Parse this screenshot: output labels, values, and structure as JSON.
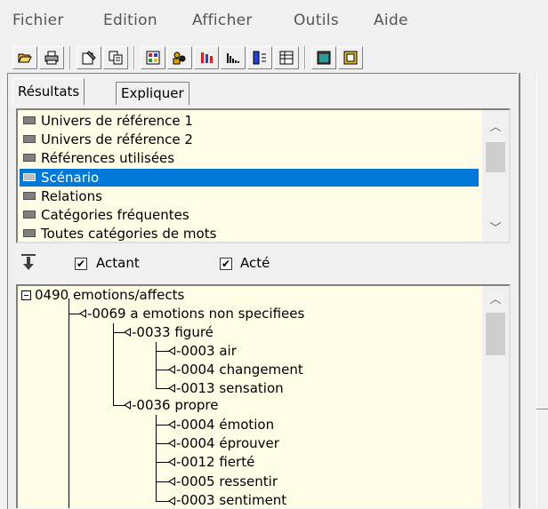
{
  "menu": [
    "Fichier",
    "Edition",
    "Afficher",
    "Outils",
    "Aide"
  ],
  "toolbar": {
    "buttons": [
      "open-folder-icon",
      "print-icon",
      "properties-icon",
      "copy-icon",
      "grid-icon",
      "people-icon",
      "bars-icon",
      "histogram-icon",
      "split-icon",
      "table-icon",
      "window-icon",
      "export-icon"
    ]
  },
  "tabs": {
    "results": "Résultats",
    "explain": "Expliquer"
  },
  "list": {
    "items": [
      "Univers de référence 1",
      "Univers de référence 2",
      "Références utilisées",
      "Scénario",
      "Relations",
      "Catégories fréquentes",
      "Toutes catégories de mots"
    ],
    "selected_index": 3
  },
  "checks": {
    "actant": {
      "label": "Actant",
      "checked": true
    },
    "acte": {
      "label": "Acté",
      "checked": true
    }
  },
  "tree": {
    "root": "0490 emotions/affects",
    "n1": "-0069 a emotions non specifiees",
    "n2a": "-0033 figuré",
    "n2a_1": "-0003 air",
    "n2a_2": "-0004 changement",
    "n2a_3": "-0013 sensation",
    "n2b": "-0036 propre",
    "n2b_1": "-0004 émotion",
    "n2b_2": "-0004 éprouver",
    "n2b_3": "-0012 fierté",
    "n2b_4": "-0005 ressentir",
    "n2b_5": "-0003 sentiment"
  },
  "colors": {
    "list_bg": "#fffde6",
    "selection": "#0078d7"
  }
}
